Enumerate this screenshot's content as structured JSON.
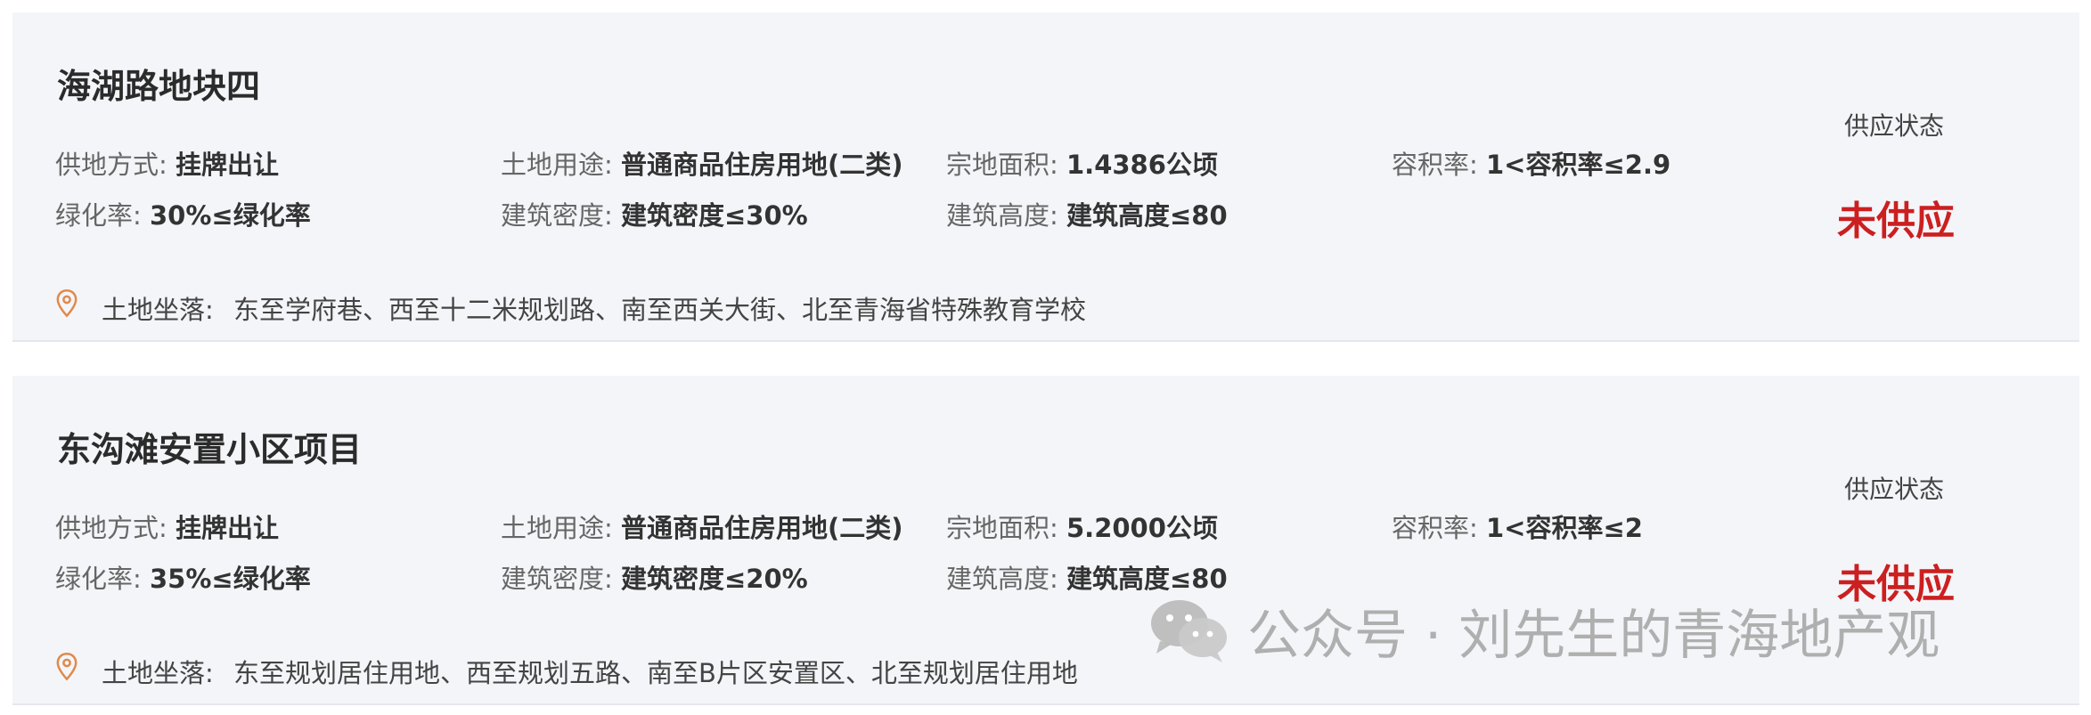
{
  "parcels": [
    {
      "title": "海湖路地块四",
      "supply_method": {
        "label": "供地方式:",
        "value": "挂牌出让"
      },
      "land_use": {
        "label": "土地用途:",
        "value": "普通商品住房用地(二类)"
      },
      "area": {
        "label": "宗地面积:",
        "value": "1.4386公顷"
      },
      "far": {
        "label": "容积率:",
        "value": "1<容积率≤2.9"
      },
      "green_rate": {
        "label": "绿化率:",
        "value": "30%≤绿化率"
      },
      "density": {
        "label": "建筑密度:",
        "value": "建筑密度≤30%"
      },
      "height": {
        "label": "建筑高度:",
        "value": "建筑高度≤80"
      },
      "status_label": "供应状态",
      "status_value": "未供应",
      "location": {
        "label": "土地坐落:",
        "value": "东至学府巷、西至十二米规划路、南至西关大街、北至青海省特殊教育学校"
      }
    },
    {
      "title": "东沟滩安置小区项目",
      "supply_method": {
        "label": "供地方式:",
        "value": "挂牌出让"
      },
      "land_use": {
        "label": "土地用途:",
        "value": "普通商品住房用地(二类)"
      },
      "area": {
        "label": "宗地面积:",
        "value": "5.2000公顷"
      },
      "far": {
        "label": "容积率:",
        "value": "1<容积率≤2"
      },
      "green_rate": {
        "label": "绿化率:",
        "value": "35%≤绿化率"
      },
      "density": {
        "label": "建筑密度:",
        "value": "建筑密度≤20%"
      },
      "height": {
        "label": "建筑高度:",
        "value": "建筑高度≤80"
      },
      "status_label": "供应状态",
      "status_value": "未供应",
      "location": {
        "label": "土地坐落:",
        "value": "东至规划居住用地、西至规划五路、南至B片区安置区、北至规划居住用地"
      }
    }
  ],
  "watermark": {
    "text": "公众号 · 刘先生的青海地产观",
    "icon": "wechat-icon"
  },
  "colors": {
    "status": "#cc1f1f",
    "card_bg": "#f4f5f9",
    "pin": "#e0894a"
  }
}
